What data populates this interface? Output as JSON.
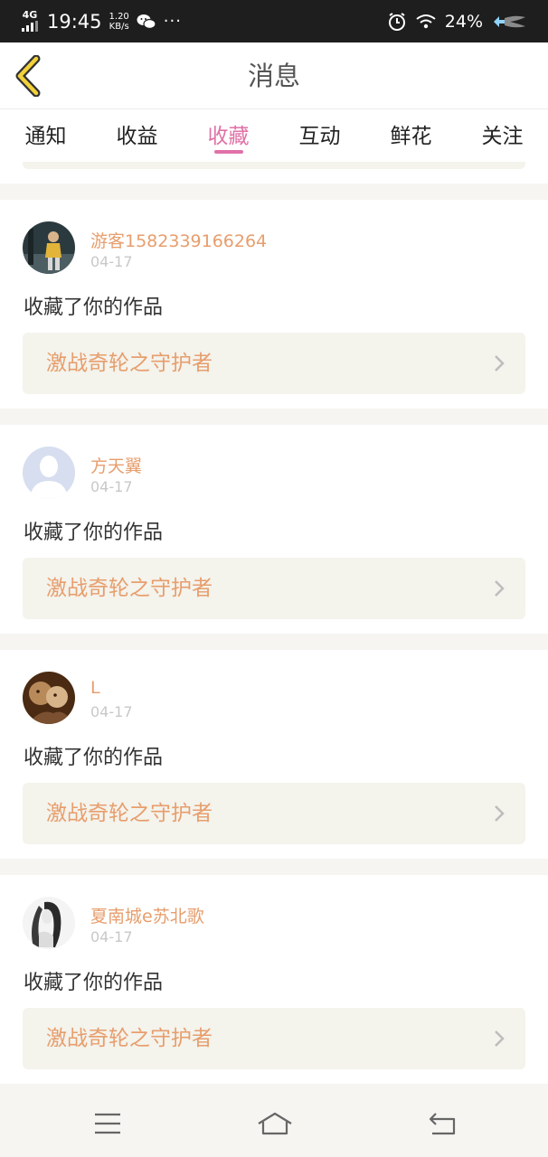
{
  "status_bar": {
    "network": "4G",
    "time": "19:45",
    "speed_value": "1.20",
    "speed_unit": "KB/s",
    "battery": "24%",
    "more": "···"
  },
  "header": {
    "title": "消息"
  },
  "tabs": [
    {
      "label": "通知",
      "active": false
    },
    {
      "label": "收益",
      "active": false
    },
    {
      "label": "收藏",
      "active": true
    },
    {
      "label": "互动",
      "active": false
    },
    {
      "label": "鲜花",
      "active": false
    },
    {
      "label": "关注",
      "active": false
    }
  ],
  "items": [
    {
      "user": "游客1582339166264",
      "date": "04-17",
      "action": "收藏了你的作品",
      "work": "激战奇轮之守护者",
      "avatar": "photo-avatar"
    },
    {
      "user": "方天翼",
      "date": "04-17",
      "action": "收藏了你的作品",
      "work": "激战奇轮之守护者",
      "avatar": "default-avatar"
    },
    {
      "user": "L",
      "date": "04-17",
      "action": "收藏了你的作品",
      "work": "激战奇轮之守护者",
      "avatar": "sepia-photo-avatar"
    },
    {
      "user": "夏南城e苏北歌",
      "date": "04-17",
      "action": "收藏了你的作品",
      "work": "激战奇轮之守护者",
      "avatar": "sketch-avatar"
    }
  ],
  "colors": {
    "accent": "#e071a7",
    "username": "#e79e6d",
    "work_box": "#f4f3ec"
  }
}
